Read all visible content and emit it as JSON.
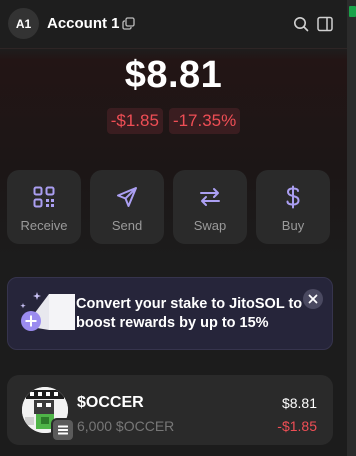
{
  "header": {
    "avatar_initials": "A1",
    "account_name": "Account 1",
    "icons": [
      "copy-icon",
      "search-icon",
      "sidebar-toggle-icon"
    ]
  },
  "balance": {
    "total": "$8.81",
    "change_usd": "-$1.85",
    "change_pct": "-17.35%"
  },
  "actions": [
    {
      "label": "Receive",
      "icon": "qr-code-icon"
    },
    {
      "label": "Send",
      "icon": "send-icon"
    },
    {
      "label": "Swap",
      "icon": "swap-icon"
    },
    {
      "label": "Buy",
      "icon": "dollar-icon"
    }
  ],
  "promo": {
    "text": "Convert your stake to JitoSOL to boost rewards by up to 15%",
    "close_icon": "close-icon"
  },
  "tokens": [
    {
      "name": "$OCCER",
      "amount": "6,000 $OCCER",
      "value": "$8.81",
      "change": "-$1.85"
    }
  ],
  "colors": {
    "background": "#1c1c1c",
    "card": "#2a2a2a",
    "negative": "#ef4e55",
    "accent": "#ab9ff2"
  }
}
